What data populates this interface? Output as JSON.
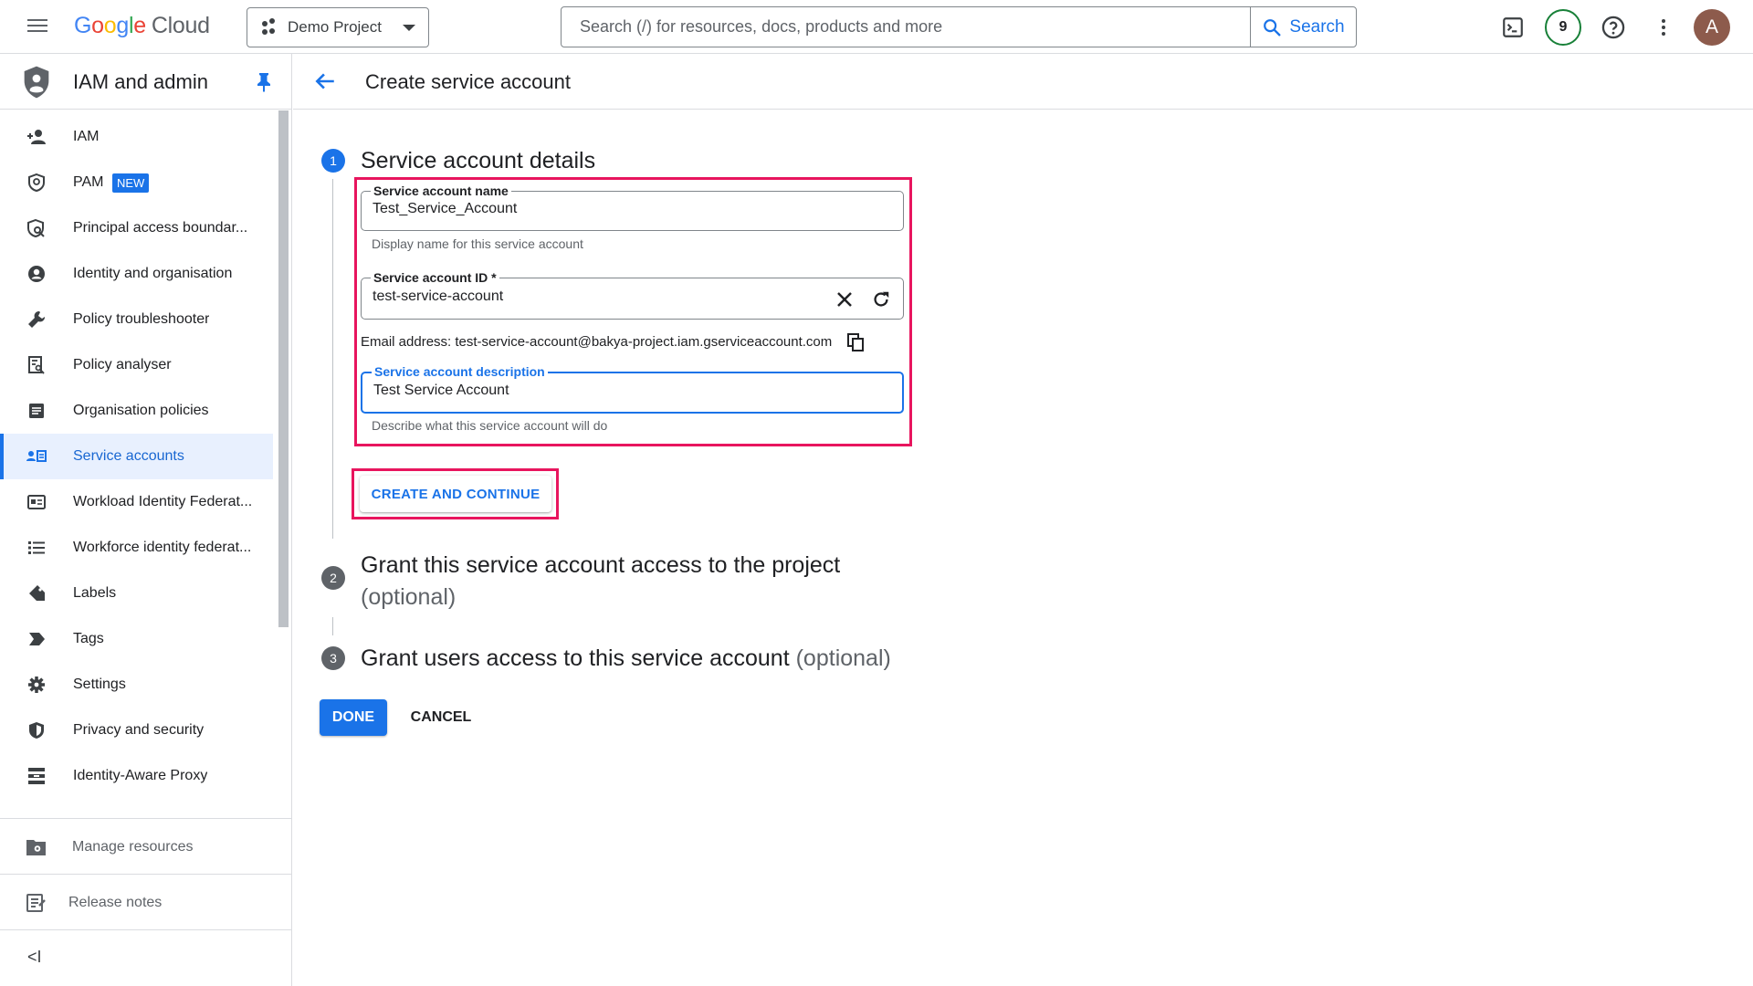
{
  "app": {
    "logo_google": "Google",
    "logo_cloud": "Cloud"
  },
  "topbar": {
    "project_name": "Demo Project",
    "search_placeholder": "Search (/) for resources, docs, products and more",
    "search_button": "Search",
    "notifications_count": "9",
    "avatar_initial": "A",
    "icons": [
      "menu-icon",
      "project-icon",
      "search-icon",
      "terminal-icon",
      "help-icon",
      "more-vert-icon"
    ]
  },
  "sidebar": {
    "title": "IAM and admin",
    "items": [
      {
        "label": "IAM",
        "icon": "person-add-icon"
      },
      {
        "label": "PAM",
        "icon": "shield-check-icon",
        "badge": "NEW"
      },
      {
        "label": "Principal access boundar...",
        "icon": "shield-search-icon"
      },
      {
        "label": "Identity and organisation",
        "icon": "account-circle-icon"
      },
      {
        "label": "Policy troubleshooter",
        "icon": "wrench-icon"
      },
      {
        "label": "Policy analyser",
        "icon": "document-search-icon"
      },
      {
        "label": "Organisation policies",
        "icon": "list-box-icon"
      },
      {
        "label": "Service accounts",
        "icon": "service-account-icon",
        "active": true
      },
      {
        "label": "Workload Identity Federat...",
        "icon": "id-card-icon"
      },
      {
        "label": "Workforce identity federat...",
        "icon": "list-icon"
      },
      {
        "label": "Labels",
        "icon": "label-icon"
      },
      {
        "label": "Tags",
        "icon": "tag-arrow-icon"
      },
      {
        "label": "Settings",
        "icon": "gear-icon"
      },
      {
        "label": "Privacy and security",
        "icon": "shield-icon"
      },
      {
        "label": "Identity-Aware Proxy",
        "icon": "proxy-icon"
      }
    ],
    "manage_resources": "Manage resources",
    "release_notes": "Release notes",
    "collapse_label": "<I"
  },
  "page": {
    "title": "Create service account"
  },
  "steps": [
    {
      "number": "1",
      "title": "Service account details",
      "optional": ""
    },
    {
      "number": "2",
      "title": "Grant this service account access to the project",
      "optional": "(optional)"
    },
    {
      "number": "3",
      "title": "Grant users access to this service account",
      "optional": "(optional)"
    }
  ],
  "form": {
    "name_label": "Service account name",
    "name_value": "Test_Service_Account",
    "name_helper": "Display name for this service account",
    "id_label": "Service account ID *",
    "id_value": "test-service-account",
    "email_prefix": "Email address: ",
    "email_value": "test-service-account@bakya-project.iam.gserviceaccount.com",
    "desc_label": "Service account description",
    "desc_value": "Test Service Account",
    "desc_helper": "Describe what this service account will do",
    "create_button": "CREATE AND CONTINUE"
  },
  "actions": {
    "done": "DONE",
    "cancel": "CANCEL"
  },
  "colors": {
    "accent": "#1a73e8",
    "highlight": "#e8155e",
    "badge_ring": "#188038",
    "avatar_bg": "#8d5b4c"
  }
}
